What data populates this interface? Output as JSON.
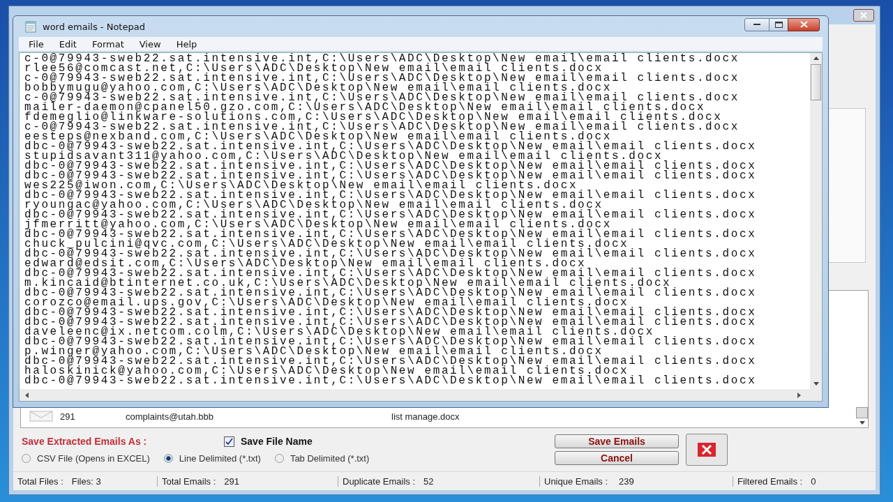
{
  "notepad": {
    "title": "word emails - Notepad",
    "menu": [
      "File",
      "Edit",
      "Format",
      "View",
      "Help"
    ],
    "lines": [
      "c-0@79943-sweb22.sat.intensive.int,C:\\Users\\ADC\\Desktop\\New email\\email clients.docx",
      "rlee56@comcast.net,C:\\Users\\ADC\\Desktop\\New email\\email clients.docx",
      "c-0@79943-sweb22.sat.intensive.int,C:\\Users\\ADC\\Desktop\\New email\\email clients.docx",
      "bobbymugu@yahoo.com,C:\\Users\\ADC\\Desktop\\New email\\email clients.docx",
      "c-0@79943-sweb22.sat.intensive.int,C:\\Users\\ADC\\Desktop\\New email\\email clients.docx",
      "mailer-daemon@cpanel50.gzo.com,C:\\Users\\ADC\\Desktop\\New email\\email clients.docx",
      "fdemeglio@linkware-solutions.com,C:\\Users\\ADC\\Desktop\\New email\\email clients.docx",
      "c-0@79943-sweb22.sat.intensive.int,C:\\Users\\ADC\\Desktop\\New email\\email clients.docx",
      "eesteps@nexband.com,C:\\Users\\ADC\\Desktop\\New email\\email clients.docx",
      "dbc-0@79943-sweb22.sat.intensive.int,C:\\Users\\ADC\\Desktop\\New email\\email clients.docx",
      "stupidsavant311@yahoo.com,C:\\Users\\ADC\\Desktop\\New email\\email clients.docx",
      "dbc-0@79943-sweb22.sat.intensive.int,C:\\Users\\ADC\\Desktop\\New email\\email clients.docx",
      "dbc-0@79943-sweb22.sat.intensive.int,C:\\Users\\ADC\\Desktop\\New email\\email clients.docx",
      "wes225@iwon.com,C:\\Users\\ADC\\Desktop\\New email\\email clients.docx",
      "dbc-0@79943-sweb22.sat.intensive.int,C:\\Users\\ADC\\Desktop\\New email\\email clients.docx",
      "ryoungac@yahoo.com,C:\\Users\\ADC\\Desktop\\New email\\email clients.docx",
      "dbc-0@79943-sweb22.sat.intensive.int,C:\\Users\\ADC\\Desktop\\New email\\email clients.docx",
      "jfmerritt@yahoo.com,C:\\Users\\ADC\\Desktop\\New email\\email clients.docx",
      "dbc-0@79943-sweb22.sat.intensive.int,C:\\Users\\ADC\\Desktop\\New email\\email clients.docx",
      "chuck_pulcini@qvc.com,C:\\Users\\ADC\\Desktop\\New email\\email clients.docx",
      "dbc-0@79943-sweb22.sat.intensive.int,C:\\Users\\ADC\\Desktop\\New email\\email clients.docx",
      "edward@edsit.com,C:\\Users\\ADC\\Desktop\\New email\\email clients.docx",
      "dbc-0@79943-sweb22.sat.intensive.int,C:\\Users\\ADC\\Desktop\\New email\\email clients.docx",
      "m.kincaid@btinternet.co.uk,C:\\Users\\ADC\\Desktop\\New email\\email clients.docx",
      "dbc-0@79943-sweb22.sat.intensive.int,C:\\Users\\ADC\\Desktop\\New email\\email clients.docx",
      "corozco@email.ups.gov,C:\\Users\\ADC\\Desktop\\New email\\email clients.docx",
      "dbc-0@79943-sweb22.sat.intensive.int,C:\\Users\\ADC\\Desktop\\New email\\email clients.docx",
      "dbc-0@79943-sweb22.sat.intensive.int,C:\\Users\\ADC\\Desktop\\New email\\email clients.docx",
      "daveleenc@ix.netcom.colm,C:\\Users\\ADC\\Desktop\\New email\\email clients.docx",
      "dbc-0@79943-sweb22.sat.intensive.int,C:\\Users\\ADC\\Desktop\\New email\\email clients.docx",
      "p.winger@yahoo.com,C:\\Users\\ADC\\Desktop\\New email\\email clients.docx",
      "dbc-0@79943-sweb22.sat.intensive.int,C:\\Users\\ADC\\Desktop\\New email\\email clients.docx",
      "haloskinick@yahoo.com,C:\\Users\\ADC\\Desktop\\New email\\email clients.docx",
      "dbc-0@79943-sweb22.sat.intensive.int,C:\\Users\\ADC\\Desktop\\New email\\email clients.docx"
    ]
  },
  "list_row": {
    "count": "291",
    "email": "complaints@utah.bbb",
    "file": "list manage.docx"
  },
  "save_options": {
    "label": "Save Extracted Emails As :",
    "save_file_name": {
      "label": "Save File Name",
      "checked": true
    },
    "formats": [
      {
        "label": "CSV File (Opens in EXCEL)",
        "selected": false
      },
      {
        "label": "Line Delimited (*.txt)",
        "selected": true
      },
      {
        "label": "Tab Delimited (*.txt)",
        "selected": false
      }
    ]
  },
  "buttons": {
    "save": "Save Emails",
    "cancel": "Cancel"
  },
  "status_bar": [
    {
      "label": "Total Files :",
      "value": "Files: 3"
    },
    {
      "label": "Total Emails :",
      "value": "291"
    },
    {
      "label": "Duplicate Emails :",
      "value": "52"
    },
    {
      "label": "Unique Emails :",
      "value": "239"
    },
    {
      "label": "Filtered Emails :",
      "value": "0"
    }
  ]
}
